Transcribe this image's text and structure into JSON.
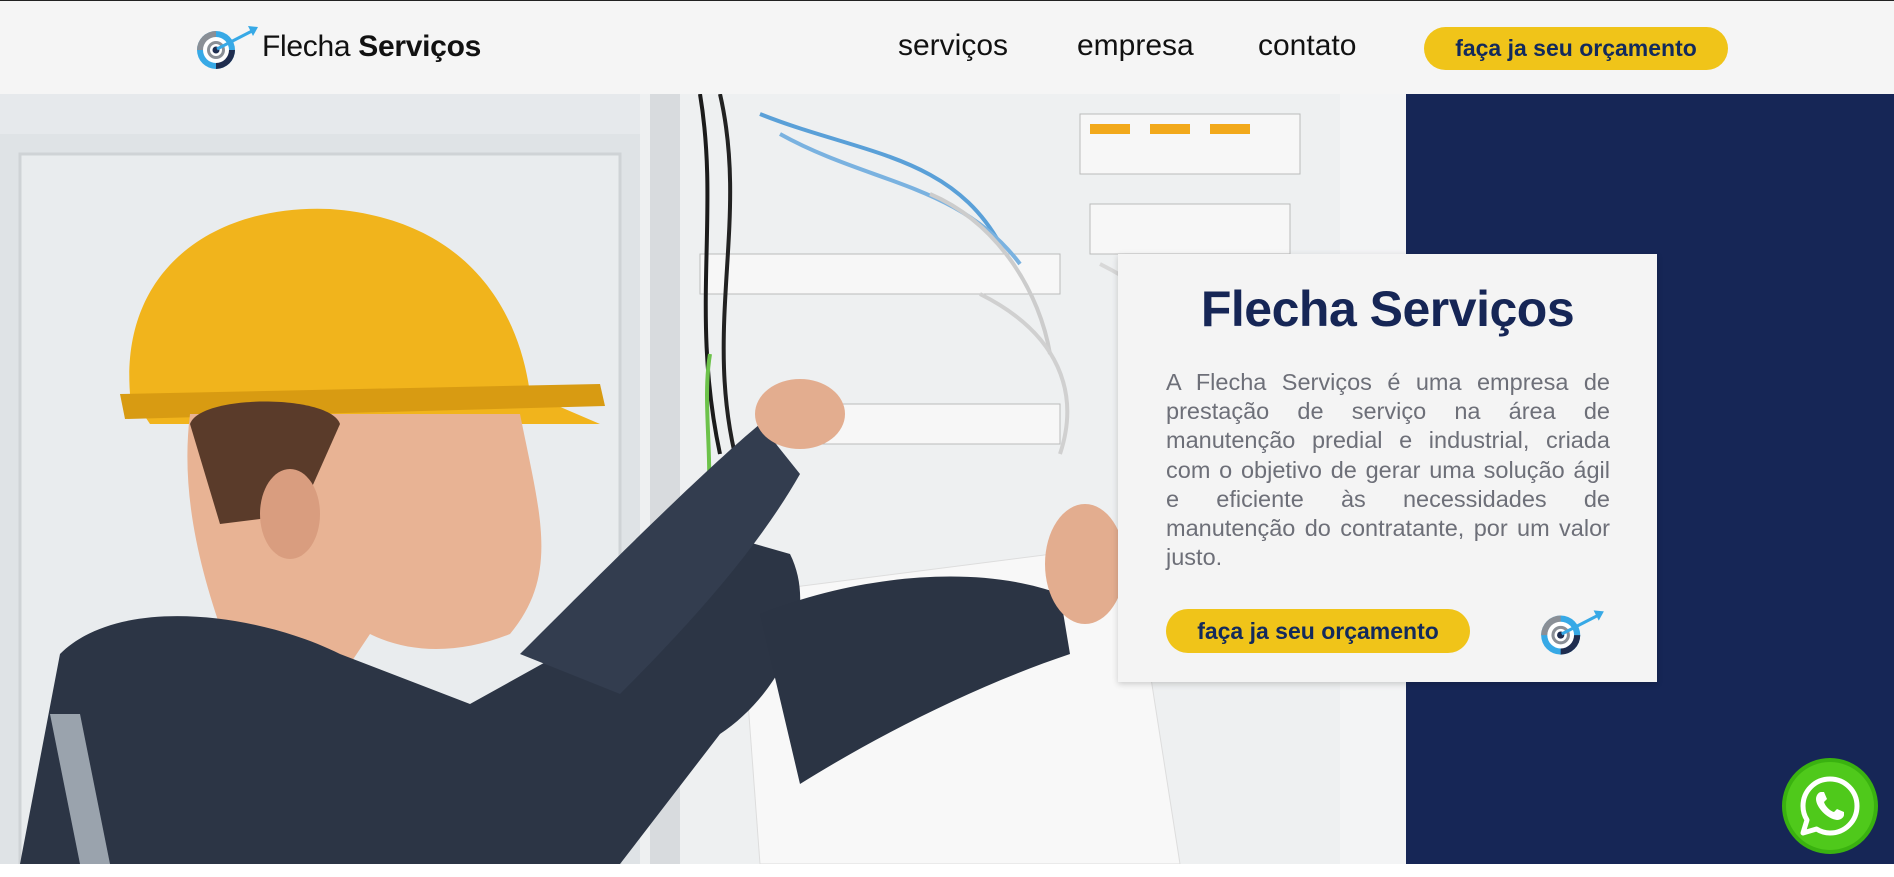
{
  "header": {
    "brand_regular": "Flecha",
    "brand_bold": "Serviços",
    "nav": {
      "servicos": "serviços",
      "empresa": "empresa",
      "contato": "contato"
    },
    "cta_label": "faça ja seu orçamento"
  },
  "hero": {
    "photo_description_icon": "electrician-photo",
    "card": {
      "title": "Flecha Serviços",
      "description": "A Flecha Serviços é uma empresa de prestação de serviço na área de manutenção predial e industrial, criada com o objetivo de gerar uma solução ágil e eficiente às necessidades de manutenção do contratante, por um valor justo.",
      "cta_label": "faça ja seu orçamento",
      "icon": "target-arrow-icon"
    }
  },
  "floating": {
    "whatsapp_icon": "whatsapp-icon"
  },
  "colors": {
    "navy": "#162656",
    "yellow": "#f0c419",
    "header_bg": "#f5f5f5",
    "whatsapp_green": "#4fc91b",
    "text_gray": "#6d6f78"
  }
}
